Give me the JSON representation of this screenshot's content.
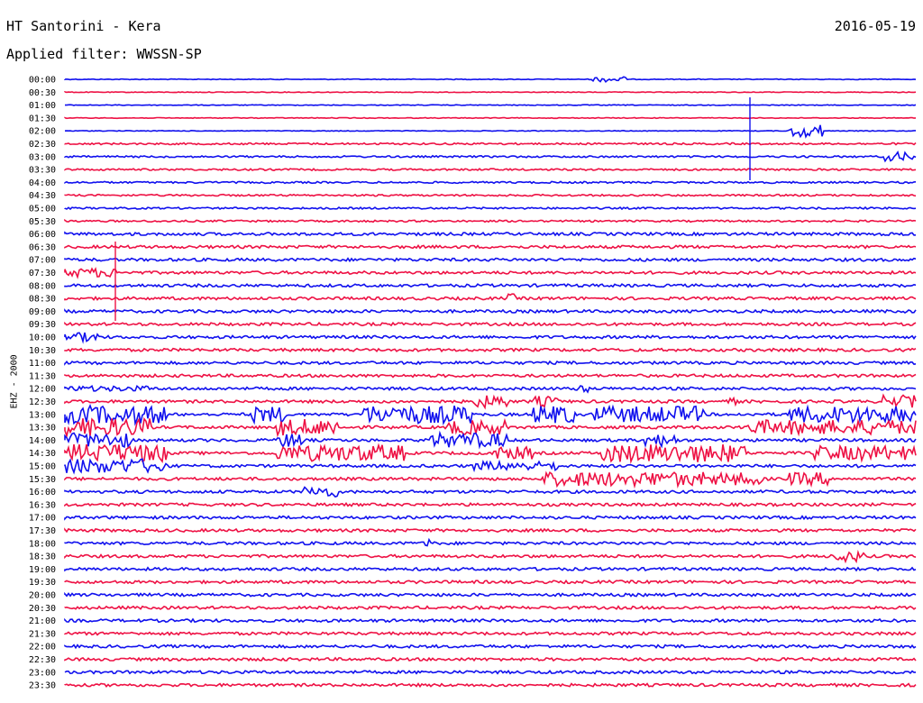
{
  "header": {
    "station": "HT Santorini - Kera",
    "date": "2016-05-19",
    "filter": "Applied filter: WWSSN-SP"
  },
  "channel": "EHZ - 2000",
  "colors": {
    "even": "#1010ee",
    "odd": "#ee1144"
  },
  "time_labels": [
    "00:00",
    "00:30",
    "01:00",
    "01:30",
    "02:00",
    "02:30",
    "03:00",
    "03:30",
    "04:00",
    "04:30",
    "05:00",
    "05:30",
    "06:00",
    "06:30",
    "07:00",
    "07:30",
    "08:00",
    "08:30",
    "09:00",
    "09:30",
    "10:00",
    "10:30",
    "11:00",
    "11:30",
    "12:00",
    "12:30",
    "13:00",
    "13:30",
    "14:00",
    "14:30",
    "15:00",
    "15:30",
    "16:00",
    "16:30",
    "17:00",
    "17:30",
    "18:00",
    "18:30",
    "19:00",
    "19:30",
    "20:00",
    "20:30",
    "21:00",
    "21:30",
    "22:00",
    "22:30",
    "23:00",
    "23:30"
  ]
}
